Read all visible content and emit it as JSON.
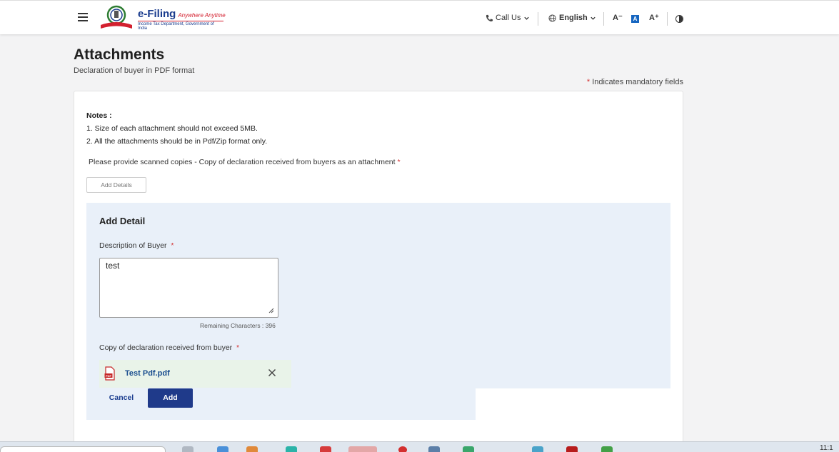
{
  "header": {
    "logo_title": "e-Filing",
    "logo_tagline": "Anywhere Anytime",
    "logo_sub": "Income Tax Department, Government of India",
    "call_us": "Call Us",
    "language": "English",
    "font_decrease": "A⁻",
    "font_default": "A",
    "font_increase": "A⁺"
  },
  "page": {
    "title": "Attachments",
    "subtitle": "Declaration of buyer in PDF format",
    "mandatory_note": "Indicates mandatory fields"
  },
  "notes": {
    "title": "Notes :",
    "items": [
      "1. Size of each attachment should not exceed 5MB.",
      "2. All the attachments should be in Pdf/Zip format only."
    ]
  },
  "instruction": "Please provide scanned copies - Copy of declaration received from buyers as an attachment",
  "add_details_label": "Add Details",
  "detail_form": {
    "title": "Add Detail",
    "description_label": "Description of Buyer",
    "description_value": "test",
    "remaining_chars": "Remaining Characters : 396",
    "copy_label": "Copy of declaration received from buyer",
    "file_name": "Test Pdf.pdf",
    "cancel_label": "Cancel",
    "add_label": "Add"
  },
  "taskbar": {
    "clock": "11:1"
  },
  "colors": {
    "primary": "#1f3a8a",
    "panel_bg": "#e9f0f9",
    "required": "#d32f2f",
    "file_bg": "#e9f3e9"
  }
}
